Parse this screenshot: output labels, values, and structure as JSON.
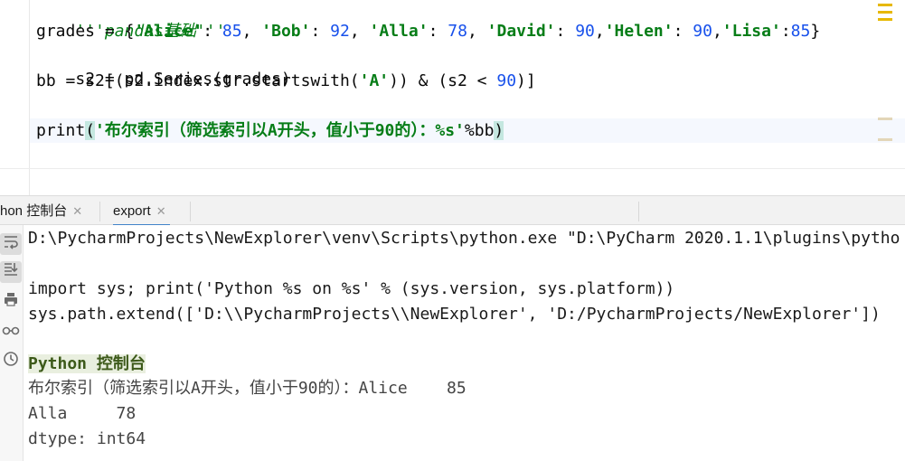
{
  "editor": {
    "lines": {
      "docstring": "'''pandas基础'''",
      "grades_prefix": "grades = {",
      "grades_k1": "'Alice'",
      "grades_v1": "85",
      "grades_k2": "'Bob'",
      "grades_v2": "92",
      "grades_k3": "'Alla'",
      "grades_v3": "78",
      "grades_k4": "'David'",
      "grades_v4": "90",
      "grades_k5": "'Helen'",
      "grades_v5": "90",
      "grades_k6": "'Lisa'",
      "grades_v6": "85",
      "s2_line": "s2 = pd.Series(grades)",
      "bb_prefix": "bb = s2[(s2.index.str.startswith(",
      "bb_str": "'A'",
      "bb_mid": ")) & (s2 < ",
      "bb_num": "90",
      "bb_suffix": ")]",
      "print_func": "print",
      "print_str": "'布尔索引（筛选索引以A开头，值小于90的）：%s'",
      "print_rest": "%bb"
    }
  },
  "tabs": {
    "console_tab": "hon 控制台",
    "export_tab": "export"
  },
  "console": {
    "line1": "D:\\PycharmProjects\\NewExplorer\\venv\\Scripts\\python.exe \"D:\\PyCharm 2020.1.1\\plugins\\pytho",
    "line2": "import sys; print('Python %s on %s' % (sys.version, sys.platform))",
    "line3": "sys.path.extend(['D:\\\\PycharmProjects\\\\NewExplorer', 'D:/PycharmProjects/NewExplorer'])",
    "label": "Python 控制台",
    "out1": "布尔索引（筛选索引以A开头，值小于90的）：Alice    85",
    "out2": "Alla     78",
    "out3": "dtype: int64"
  },
  "colors": {
    "string": "#067d17",
    "number": "#1750eb",
    "accent": "#4083c9"
  },
  "icons": [
    "soft-wrap-icon",
    "scroll-to-end-icon",
    "print-icon",
    "glasses-icon",
    "history-icon",
    "close-icon"
  ]
}
